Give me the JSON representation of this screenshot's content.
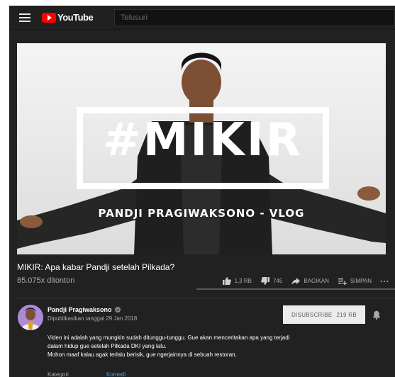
{
  "header": {
    "menu_icon": "hamburger-menu-icon",
    "logo_text": "YouTube",
    "search_placeholder": "Telusuri"
  },
  "thumbnail": {
    "hashtag_text": "#MIKIR",
    "subtitle_text": "PANDJI PRAGIWAKSONO - VLOG"
  },
  "video": {
    "title": "MIKIR: Apa kabar Pandji setelah Pilkada?",
    "views": "85.075x ditonton"
  },
  "actions": {
    "like_count": "1,3 RB",
    "dislike_count": "745",
    "share_label": "BAGIKAN",
    "save_label": "SIMPAN",
    "more_label": "..."
  },
  "channel": {
    "name": "Pandji Pragiwaksono",
    "published": "Dipublikasikan tanggal 29 Jan 2018",
    "subscribe_label": "DISUBSCRIBE",
    "subscriber_count": "219 RB"
  },
  "description": {
    "line1": "Video ini adalah yang mungkin sudah ditunggu-tunggu. Gue akan menceritakan apa yang terjadi",
    "line2": "dalam hidup gue setelah Pilkada DKI yang lalu.",
    "line3": "Mohon maaf kalau agak terlalu berisik, gue ngerjainnya di sebuah restoran.",
    "category_label": "Kategori",
    "category_value": "Komedi"
  },
  "colors": {
    "background": "#212121",
    "brand_red": "#ff0000",
    "link_blue": "#3ea6ff",
    "subscribe_bg": "#ececec"
  }
}
